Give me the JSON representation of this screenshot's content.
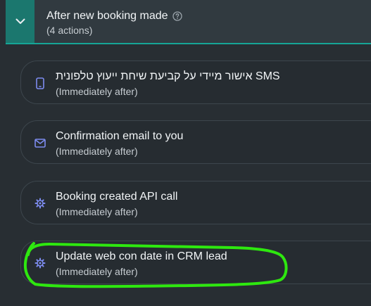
{
  "group": {
    "title": "After new booking made",
    "subtitle": "(4 actions)",
    "collapse_icon": "chevron-down-icon",
    "help_icon": "question-circle-icon"
  },
  "actions": [
    {
      "title": "אישור מיידי על קביעת שיחת ייעוץ טלפונית SMS",
      "timing": "(Immediately after)",
      "icon": "mobile-phone-icon"
    },
    {
      "title": "Confirmation email to you",
      "timing": "(Immediately after)",
      "icon": "envelope-icon"
    },
    {
      "title": "Booking created API call",
      "timing": "(Immediately after)",
      "icon": "gear-icon"
    },
    {
      "title": "Update web con date in CRM lead",
      "timing": "(Immediately after)",
      "icon": "gear-icon"
    }
  ],
  "colors": {
    "background": "#282e33",
    "accent": "#1b776e",
    "icon": "#7d8cf0",
    "highlight": "#2ee80f"
  }
}
